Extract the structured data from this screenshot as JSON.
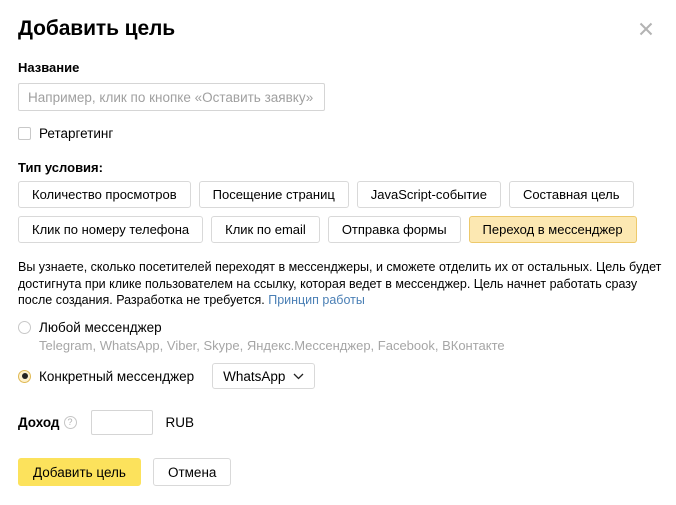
{
  "dialog": {
    "title": "Добавить цель",
    "close_icon": "close-icon"
  },
  "name_field": {
    "label": "Название",
    "value": "",
    "placeholder": "Например, клик по кнопке «Оставить заявку»"
  },
  "retargeting": {
    "label": "Ретаргетинг",
    "checked": false
  },
  "condition": {
    "label": "Тип условия:",
    "row1": [
      {
        "label": "Количество просмотров",
        "selected": false
      },
      {
        "label": "Посещение страниц",
        "selected": false
      },
      {
        "label": "JavaScript-событие",
        "selected": false
      },
      {
        "label": "Составная цель",
        "selected": false
      }
    ],
    "row2": [
      {
        "label": "Клик по номеру телефона",
        "selected": false
      },
      {
        "label": "Клик по email",
        "selected": false
      },
      {
        "label": "Отправка формы",
        "selected": false
      },
      {
        "label": "Переход в мессенджер",
        "selected": true
      }
    ]
  },
  "description": {
    "text": "Вы узнаете, сколько посетителей переходят в мессенджеры, и сможете отделить их от остальных. Цель будет достигнута при клике пользователем на ссылку, которая ведет в мессенджер. Цель начнет работать сразу после создания. Разработка не требуется. ",
    "link": "Принцип работы"
  },
  "messenger_choice": {
    "any": {
      "label": "Любой мессенджер",
      "selected": false,
      "list": "Telegram, WhatsApp, Viber, Skype, Яндекс.Мессенджер, Facebook, ВКонтакте"
    },
    "specific": {
      "label": "Конкретный мессенджер",
      "selected": true,
      "selected_value": "WhatsApp"
    }
  },
  "income": {
    "label": "Доход",
    "help_icon": "question-mark-icon",
    "value": "",
    "currency": "RUB"
  },
  "footer": {
    "submit_label": "Добавить цель",
    "cancel_label": "Отмена"
  },
  "colors": {
    "accent": "#fce25c",
    "selected_tab": "#fce8b2",
    "link": "#4a7fb5"
  }
}
